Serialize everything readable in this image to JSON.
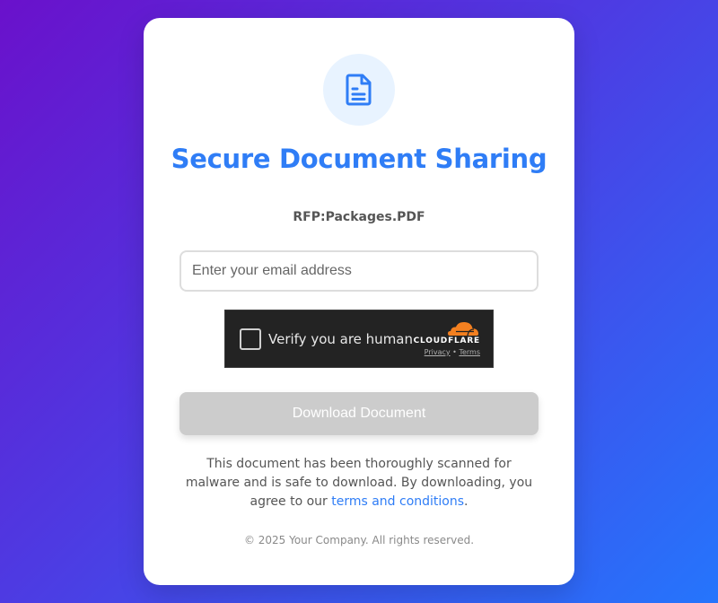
{
  "header": {
    "icon": "document-icon",
    "title": "Secure Document Sharing",
    "filename": "RFP:Packages.PDF"
  },
  "form": {
    "email_placeholder": "Enter your email address",
    "email_value": ""
  },
  "captcha": {
    "label": "Verify you are human",
    "brand": "CLOUDFLARE",
    "privacy": "Privacy",
    "separator": "•",
    "terms": "Terms"
  },
  "download_button": {
    "label": "Download Document"
  },
  "note": {
    "text": "This document has been thoroughly scanned for malware and is safe to download. By downloading, you agree to our ",
    "link": "terms and conditions",
    "end": "."
  },
  "footer": {
    "text": "© 2025 Your Company. All rights reserved."
  },
  "colors": {
    "accent": "#2f7df6",
    "gradient_start": "#6a11cb",
    "gradient_end": "#2575fc",
    "button_disabled": "#cccccc",
    "cloudflare_orange": "#f38020"
  }
}
